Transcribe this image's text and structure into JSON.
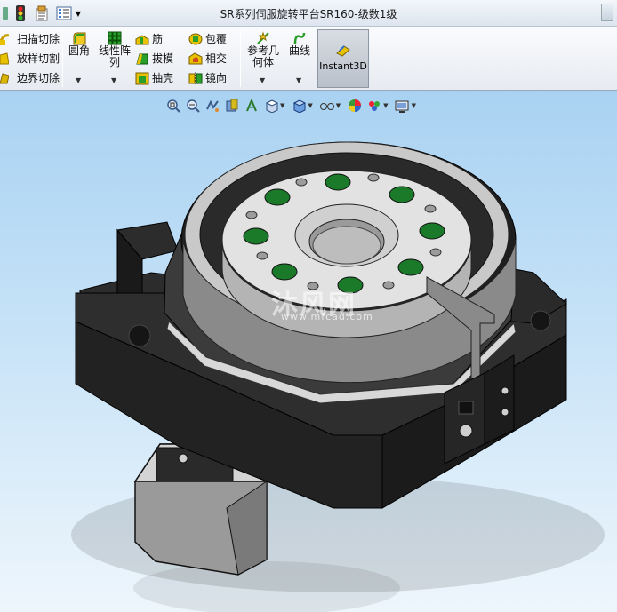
{
  "window": {
    "title": "SR系列伺服旋转平台SR160-级数1级"
  },
  "quick_access": {
    "items": [
      "traffic-light-icon",
      "file-properties-icon",
      "options-list-icon"
    ]
  },
  "ribbon": {
    "cut_group": [
      {
        "label": "扫描切除",
        "icon": "swept-cut-icon"
      },
      {
        "label": "放样切割",
        "icon": "lofted-cut-icon"
      },
      {
        "label": "边界切除",
        "icon": "boundary-cut-icon"
      }
    ],
    "fillet": {
      "label": "圆角",
      "icon": "fillet-icon"
    },
    "linear_pattern": {
      "line1": "线性阵",
      "line2": "列",
      "icon": "linear-pattern-icon"
    },
    "feature_group1": [
      {
        "label": "筋",
        "icon": "rib-icon"
      },
      {
        "label": "拔模",
        "icon": "draft-icon"
      },
      {
        "label": "抽壳",
        "icon": "shell-icon"
      }
    ],
    "feature_group2": [
      {
        "label": "包覆",
        "icon": "wrap-icon"
      },
      {
        "label": "相交",
        "icon": "intersect-icon"
      },
      {
        "label": "镜向",
        "icon": "mirror-icon"
      }
    ],
    "ref_geometry": {
      "line1": "参考几",
      "line2": "何体",
      "icon": "reference-geometry-icon"
    },
    "curves": {
      "label": "曲线",
      "icon": "curves-icon"
    },
    "instant3d": {
      "label": "Instant3D",
      "icon": "instant3d-icon",
      "active": true
    }
  },
  "viewport": {
    "background_top": "#a9d2f2",
    "background_bottom": "#eef6fc",
    "watermark": {
      "main": "沐风网",
      "sub": "www.mfcad.com"
    },
    "heads_up_toolbar": [
      {
        "name": "zoom-to-fit-icon",
        "dropdown": false
      },
      {
        "name": "zoom-to-area-icon",
        "dropdown": false
      },
      {
        "name": "previous-view-icon",
        "dropdown": false
      },
      {
        "name": "section-view-icon",
        "dropdown": false
      },
      {
        "name": "dynamic-annotation-icon",
        "dropdown": false
      },
      {
        "name": "view-orientation-icon",
        "dropdown": true
      },
      {
        "name": "display-style-icon",
        "dropdown": true
      },
      {
        "name": "hide-show-items-icon",
        "dropdown": true
      },
      {
        "name": "edit-appearance-icon",
        "dropdown": false
      },
      {
        "name": "apply-scene-icon",
        "dropdown": true
      },
      {
        "name": "view-settings-icon",
        "dropdown": true
      }
    ]
  }
}
